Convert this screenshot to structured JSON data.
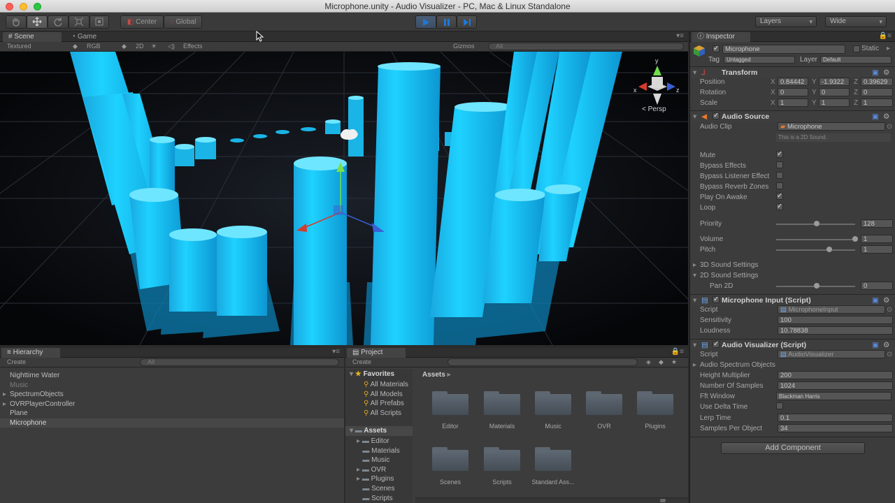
{
  "window": {
    "title": "Microphone.unity - Audio Visualizer - PC, Mac & Linux Standalone"
  },
  "toolbar": {
    "pivot_label": "Center",
    "space_label": "Global",
    "layers_label": "Layers",
    "layout_label": "Wide"
  },
  "scene_tabs": {
    "scene": "Scene",
    "game": "Game"
  },
  "scene_bar": {
    "shading": "Textured",
    "render_mode": "RGB",
    "mode_2d": "2D",
    "effects": "Effects",
    "gizmos": "Gizmos",
    "search_placeholder": "All",
    "persp_label": "< Persp"
  },
  "hierarchy": {
    "tab": "Hierarchy",
    "create": "Create",
    "search_placeholder": "All",
    "items": [
      "Nighttime Water",
      "Music",
      "SpectrumObjects",
      "OVRPlayerController",
      "Plane",
      "Microphone"
    ]
  },
  "project": {
    "tab": "Project",
    "create": "Create",
    "favorites_label": "Favorites",
    "favorites": [
      "All Materials",
      "All Models",
      "All Prefabs",
      "All Scripts"
    ],
    "assets_label": "Assets",
    "asset_tree": [
      "Editor",
      "Materials",
      "Music",
      "OVR",
      "Plugins",
      "Scenes",
      "Scripts"
    ],
    "breadcrumb": "Assets",
    "folders": [
      "Editor",
      "Materials",
      "Music",
      "OVR",
      "Plugins",
      "Scenes",
      "Scripts",
      "Standard Ass..."
    ]
  },
  "inspector": {
    "tab": "Inspector",
    "object_name": "Microphone",
    "static_label": "Static",
    "tag_label": "Tag",
    "tag_value": "Untagged",
    "layer_label": "Layer",
    "layer_value": "Default",
    "transform": {
      "title": "Transform",
      "position_label": "Position",
      "rotation_label": "Rotation",
      "scale_label": "Scale",
      "position": [
        "0.84442",
        "-1.9322",
        "0.39629"
      ],
      "rotation": [
        "0",
        "0",
        "0"
      ],
      "scale": [
        "1",
        "1",
        "1"
      ]
    },
    "audio_source": {
      "title": "Audio Source",
      "clip_label": "Audio Clip",
      "clip_value": "Microphone",
      "hint": "This is a 2D Sound.",
      "mute_label": "Mute",
      "bypass_effects_label": "Bypass Effects",
      "bypass_listener_label": "Bypass Listener Effect",
      "bypass_reverb_label": "Bypass Reverb Zones",
      "play_on_awake_label": "Play On Awake",
      "loop_label": "Loop",
      "priority_label": "Priority",
      "priority_value": "128",
      "volume_label": "Volume",
      "volume_value": "1",
      "pitch_label": "Pitch",
      "pitch_value": "1",
      "settings_3d": "3D Sound Settings",
      "settings_2d": "2D Sound Settings",
      "pan_label": "Pan 2D",
      "pan_value": "0"
    },
    "mic_input": {
      "title": "Microphone Input (Script)",
      "script_label": "Script",
      "script_value": "MicrophoneInput",
      "sensitivity_label": "Sensitivity",
      "sensitivity_value": "100",
      "loudness_label": "Loudness",
      "loudness_value": "10.78838"
    },
    "visualizer": {
      "title": "Audio Visualizer (Script)",
      "script_label": "Script",
      "script_value": "AudioVisualizer",
      "spectrum_label": "Audio Spectrum Objects",
      "height_label": "Height Multiplier",
      "height_value": "200",
      "samples_label": "Number Of Samples",
      "samples_value": "1024",
      "fft_label": "Fft Window",
      "fft_value": "Blackman Harris",
      "delta_label": "Use Delta Time",
      "lerp_label": "Lerp Time",
      "lerp_value": "0.1",
      "spo_label": "Samples Per Object",
      "spo_value": "34"
    },
    "add_component": "Add Component"
  },
  "colors": {
    "cylinder": "#19c8f5",
    "cylinder_dark": "#0a6f9a",
    "background": "#3c3c3c"
  }
}
